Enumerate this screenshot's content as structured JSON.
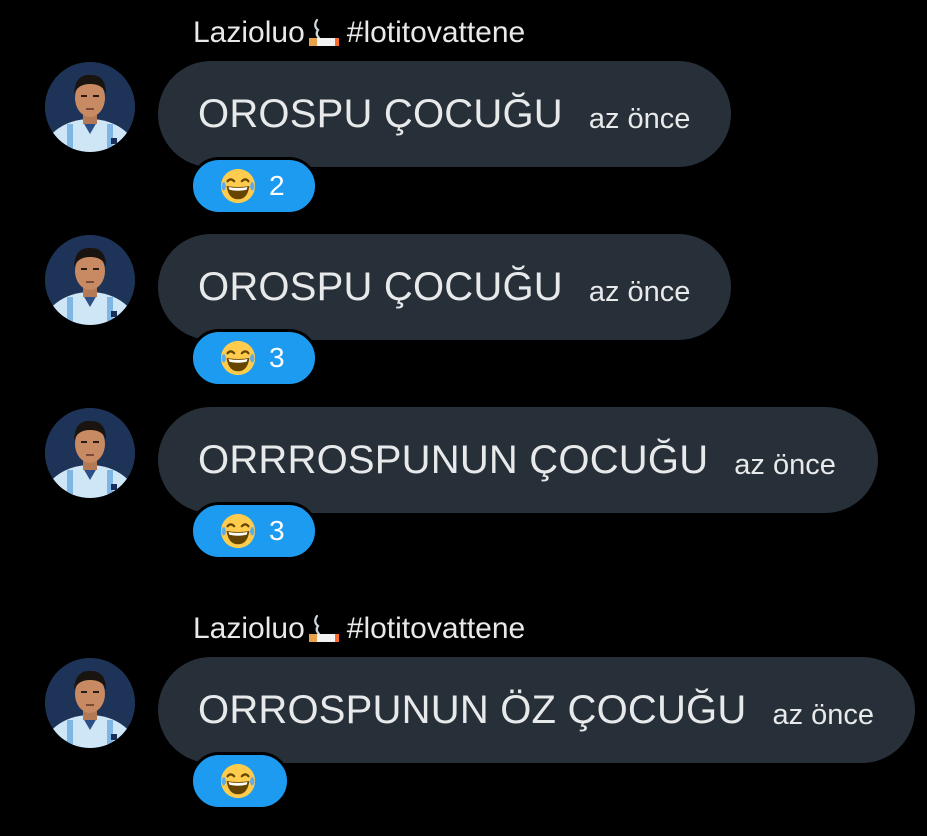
{
  "groups": [
    {
      "sender": {
        "name": "Lazioluo",
        "tag": "#lotitovattene",
        "emoji": "cigarette-icon"
      },
      "messages": [
        {
          "text": "OROSPU ÇOCUĞU",
          "time": "az önce",
          "reaction": {
            "emoji": "laughing-tears-icon",
            "count": "2"
          }
        },
        {
          "text": "OROSPU ÇOCUĞU",
          "time": "az önce",
          "reaction": {
            "emoji": "laughing-tears-icon",
            "count": "3"
          }
        },
        {
          "text": "ORRROSPUNUN ÇOCUĞU",
          "time": "az önce",
          "reaction": {
            "emoji": "laughing-tears-icon",
            "count": "3"
          }
        }
      ]
    },
    {
      "sender": {
        "name": "Lazioluo",
        "tag": "#lotitovattene",
        "emoji": "cigarette-icon"
      },
      "messages": [
        {
          "text": "ORROSPUNUN ÖZ ÇOCUĞU",
          "time": "az önce",
          "reaction": {
            "emoji": "laughing-tears-icon",
            "count": ""
          }
        }
      ]
    }
  ],
  "colors": {
    "background": "#000000",
    "bubble": "#273038",
    "reaction": "#1d9bf0",
    "text": "#e7e9ea"
  }
}
